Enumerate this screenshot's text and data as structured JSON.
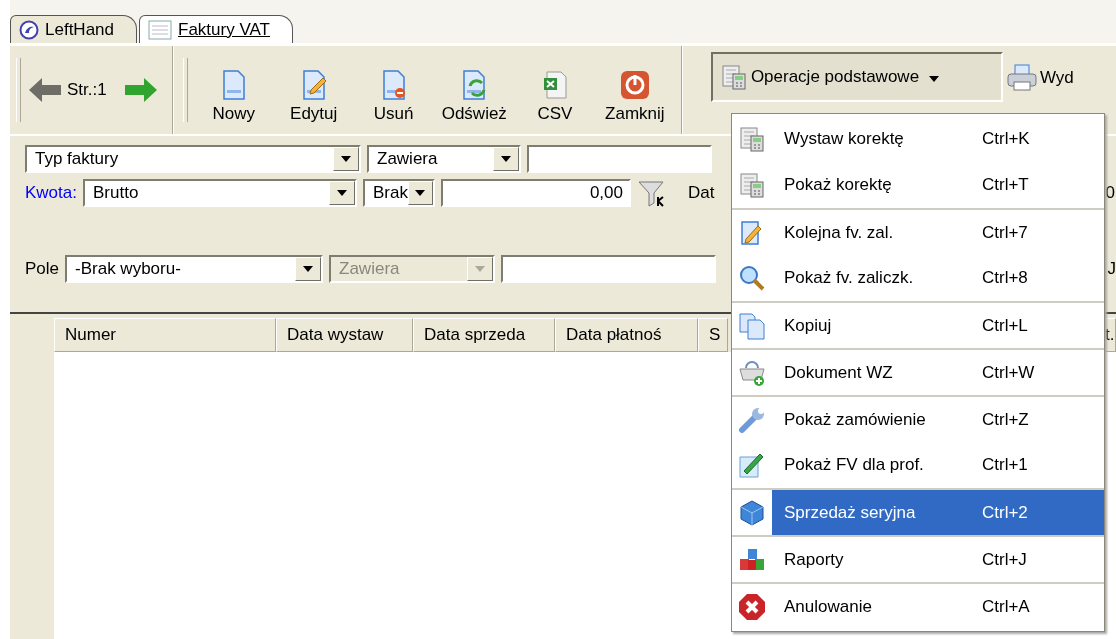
{
  "tabs": [
    {
      "label": "LeftHand",
      "selected": false
    },
    {
      "label": "Faktury VAT",
      "selected": true
    }
  ],
  "pager": {
    "label": "Str.:1"
  },
  "toolbar_buttons": [
    {
      "label": "Nowy"
    },
    {
      "label": "Edytuj"
    },
    {
      "label": "Usuń"
    },
    {
      "label": "Odśwież"
    },
    {
      "label": "CSV"
    },
    {
      "label": "Zamknij"
    }
  ],
  "operations_button": {
    "label": "Operacje podstawowe",
    "expanded": true
  },
  "print_button": {
    "label": "Wyd"
  },
  "type_filter": {
    "field": "Typ faktury",
    "condition": "Zawiera"
  },
  "amount_filter": {
    "label": "Kwota:",
    "field": "Brutto",
    "condition": "Brak",
    "value": "0,00",
    "date_label": "Dat",
    "date_value": "0"
  },
  "field_filter": {
    "label": "Pole",
    "field": "-Brak wyboru-",
    "condition": "Zawiera",
    "condition_disabled": true,
    "edge_text": "J"
  },
  "table": {
    "columns": [
      "Numer",
      "Data wystaw",
      "Data sprzeda",
      "Data płatnoś",
      "S",
      "t."
    ]
  },
  "menu": {
    "items": [
      {
        "label": "Wystaw korektę",
        "shortcut": "Ctrl+K",
        "selected": false,
        "separator_above": false
      },
      {
        "label": "Pokaż korektę",
        "shortcut": "Ctrl+T",
        "selected": false,
        "separator_above": false
      },
      {
        "label": "Kolejna fv. zal.",
        "shortcut": "Ctrl+7",
        "selected": false,
        "separator_above": true
      },
      {
        "label": "Pokaż fv. zaliczk.",
        "shortcut": "Ctrl+8",
        "selected": false,
        "separator_above": false
      },
      {
        "label": "Kopiuj",
        "shortcut": "Ctrl+L",
        "selected": false,
        "separator_above": true
      },
      {
        "label": "Dokument WZ",
        "shortcut": "Ctrl+W",
        "selected": false,
        "separator_above": true
      },
      {
        "label": "Pokaż zamówienie",
        "shortcut": "Ctrl+Z",
        "selected": false,
        "separator_above": true
      },
      {
        "label": "Pokaż FV dla prof.",
        "shortcut": "Ctrl+1",
        "selected": false,
        "separator_above": false
      },
      {
        "label": "Sprzedaż seryjna",
        "shortcut": "Ctrl+2",
        "selected": true,
        "separator_above": true
      },
      {
        "label": "Raporty",
        "shortcut": "Ctrl+J",
        "selected": false,
        "separator_above": true
      },
      {
        "label": "Anulowanie",
        "shortcut": "Ctrl+A",
        "selected": false,
        "separator_above": true
      }
    ]
  }
}
